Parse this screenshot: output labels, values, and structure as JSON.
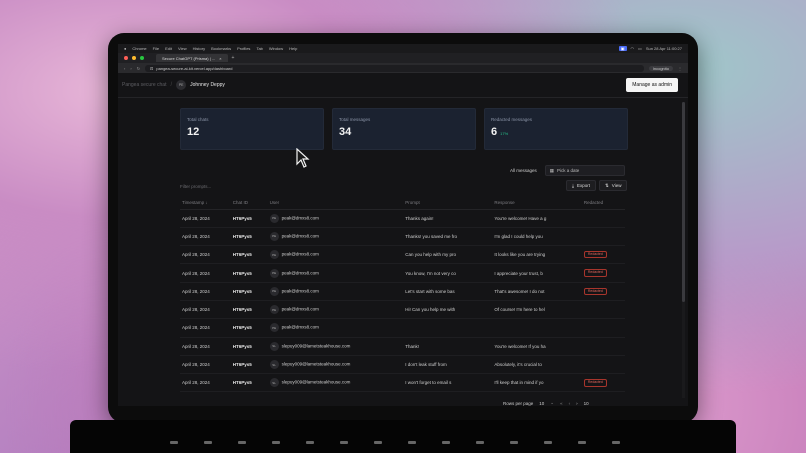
{
  "menubar": {
    "items": [
      "Chrome",
      "File",
      "Edit",
      "View",
      "History",
      "Bookmarks",
      "Profiles",
      "Tab",
      "Window",
      "Help"
    ],
    "status": "Sun 28 Apr 11:00:27"
  },
  "browser": {
    "tab_title": "Secure ChatGPT (Prisma) | ...",
    "url": "pangea-secure-ai-kit.vercel.app/dashboard",
    "incognito_label": "Incognito"
  },
  "header": {
    "breadcrumb_root": "Pangea secure chat",
    "user_initials": "PE",
    "user_name": "Johnney Deppy",
    "admin_button": "Manage as admin"
  },
  "stats": [
    {
      "label": "Total chats",
      "value": "12"
    },
    {
      "label": "Total messages",
      "value": "34"
    },
    {
      "label": "Redacted messages",
      "value": "6",
      "pct": "17%"
    }
  ],
  "filters": {
    "all_messages": "All messages",
    "date_placeholder": "Pick a date",
    "search_placeholder": "Filter prompts...",
    "export": "Export",
    "view": "View"
  },
  "table": {
    "headers": [
      "Timestamp ↓",
      "Chat ID",
      "User",
      "Prompt",
      "Response",
      "Redacted"
    ],
    "rows": [
      {
        "ts": "April 28, 2024",
        "cid": "HT6Pys5",
        "ini": "PE",
        "user": "peak@dmxs8.com",
        "prompt": "Thanks again!",
        "resp": "You're welcome! Have a g",
        "red": ""
      },
      {
        "ts": "April 28, 2024",
        "cid": "HT6Pys5",
        "ini": "PE",
        "user": "peak@dmxs8.com",
        "prompt": "Thanks! you saved me fro",
        "resp": "I'm glad I could help you",
        "red": ""
      },
      {
        "ts": "April 28, 2024",
        "cid": "HT6Pys5",
        "ini": "PE",
        "user": "peak@dmxs8.com",
        "prompt": "Can you help with my pro",
        "resp": "It looks like you are trying",
        "red": "Redacted"
      },
      {
        "ts": "April 28, 2024",
        "cid": "HT6Pys5",
        "ini": "PE",
        "user": "peak@dmxs8.com",
        "prompt": "You know, I'm not very co",
        "resp": "I appreciate your trust, b",
        "red": "Redacted"
      },
      {
        "ts": "April 28, 2024",
        "cid": "HT6Pys5",
        "ini": "PE",
        "user": "peak@dmxs8.com",
        "prompt": "Let's start with some bas",
        "resp": "That's awesome! I do not",
        "red": "Redacted"
      },
      {
        "ts": "April 28, 2024",
        "cid": "HT6Pys5",
        "ini": "PE",
        "user": "peak@dmxs8.com",
        "prompt": "Hi! Can you help me with",
        "resp": "Of course! I'm here to hel",
        "red": ""
      },
      {
        "ts": "April 28, 2024",
        "cid": "HT6Pys5",
        "ini": "PE",
        "user": "peak@dmxs8.com",
        "prompt": "",
        "resp": "",
        "red": ""
      },
      {
        "ts": "April 28, 2024",
        "cid": "HT6Pys5",
        "ini": "SL",
        "user": "slepuy009@lametsteakhouse.com",
        "prompt": "Thank!",
        "resp": "You're welcome! If you ha",
        "red": ""
      },
      {
        "ts": "April 28, 2024",
        "cid": "HT6Pys5",
        "ini": "SL",
        "user": "slepuy009@lametsteakhouse.com",
        "prompt": "I don't leak stuff from",
        "resp": "Absolutely, it's crucial to",
        "red": ""
      },
      {
        "ts": "April 28, 2024",
        "cid": "HT6Pys5",
        "ini": "SL",
        "user": "slepuy009@lametsteakhouse.com",
        "prompt": "I won't forget to email s",
        "resp": "I'll keep that in mind if yo",
        "red": "Redacted"
      }
    ]
  },
  "pager": {
    "label": "Rows per page",
    "size": "10",
    "last": "10"
  },
  "colors": {
    "accent_green": "#27c28a",
    "redacted_red": "#e0645a",
    "card_bg": "#1b2230"
  }
}
